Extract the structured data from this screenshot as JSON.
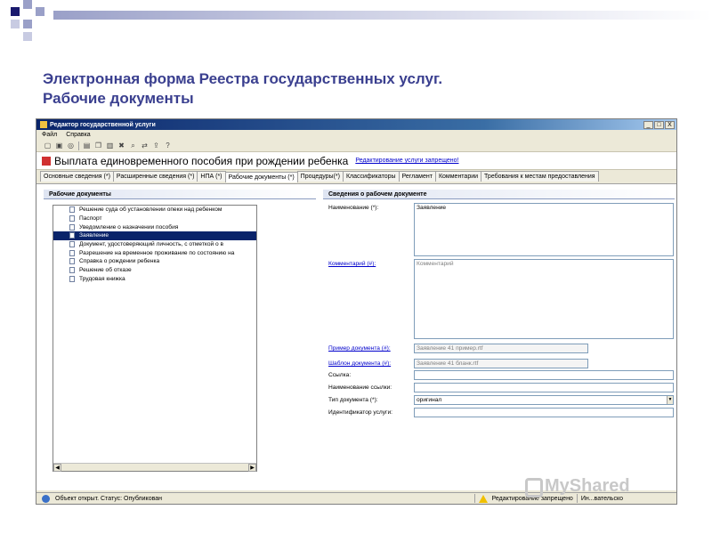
{
  "slide": {
    "title_line1": "Электронная форма Реестра государственных услуг.",
    "title_line2": "Рабочие документы"
  },
  "colors": {
    "title": "#3a3f8f",
    "selection": "#0a246a",
    "link": "#0000cc",
    "deco_dark": "#1a1a6e",
    "deco_light": "#9aa0c8"
  },
  "window": {
    "title": "Редактор государственной услуги",
    "controls": [
      "_",
      "□",
      "X"
    ]
  },
  "menu": [
    "Файл",
    "Справка"
  ],
  "toolbar_icons": [
    "new-icon",
    "save-icon",
    "refresh-icon",
    "print-icon",
    "copy-icon",
    "paste-icon",
    "delete-icon",
    "find-icon",
    "move-icon",
    "export-icon",
    "help-icon"
  ],
  "service": {
    "title": "Выплата единовременного пособия при рождении ребенка",
    "edit_link": "Редактирование услуги запрещено!"
  },
  "tabs": [
    {
      "label": "Основные сведения (*)",
      "active": false
    },
    {
      "label": "Расширенные сведения (*)",
      "active": false
    },
    {
      "label": "НПА (*)",
      "active": false
    },
    {
      "label": "Рабочие документы (*)",
      "active": true
    },
    {
      "label": "Процедуры(*)",
      "active": false
    },
    {
      "label": "Классификаторы",
      "active": false
    },
    {
      "label": "Регламент",
      "active": false
    },
    {
      "label": "Комментарии",
      "active": false
    },
    {
      "label": "Требования к местам предоставления",
      "active": false
    }
  ],
  "left_panel": {
    "header": "Рабочие документы",
    "items": [
      "Решение суда об установлении опеки над ребенком",
      "Паспорт",
      "Уведомление о назначении пособия",
      "Заявление",
      "Документ, удостоверяющий личность, с отметкой о в",
      "Разрешение на временное проживание по состоянию на",
      "Справка о рождении ребенка",
      "Решение об отказе",
      "Трудовая книжка"
    ],
    "selected_index": 3
  },
  "right_panel": {
    "header": "Сведения о рабочем документе",
    "name_label": "Наименование (*):",
    "name_value": "Заявление",
    "comment_label": "Комментарий (#):",
    "comment_placeholder": "Комментарий",
    "example_label": "Пример документа (#):",
    "example_value": "Заявление 41 пример.rtf",
    "template_label": "Шаблон документа (#):",
    "template_value": "Заявление 41 бланк.rtf",
    "link_label": "Ссылка:",
    "link_value": "",
    "link_name_label": "Наименование ссылки:",
    "link_name_value": "",
    "doctype_label": "Тип документа (*):",
    "doctype_value": "оригинал",
    "service_id_label": "Идентификатор услуги:",
    "service_id_value": ""
  },
  "status": {
    "text": "Объект открыт. Статус: Опубликован",
    "editing": "Редактирование запрещено",
    "user": "Ин...вательско"
  },
  "watermark": "MyShared"
}
